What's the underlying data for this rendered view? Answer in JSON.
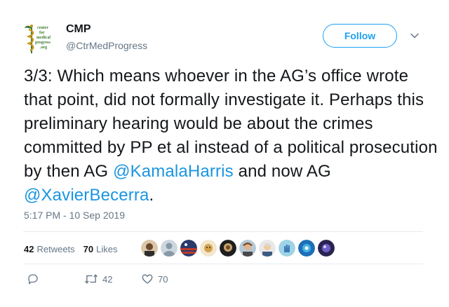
{
  "author": {
    "name": "CMP",
    "handle": "@CtrMedProgress",
    "logo_text": [
      "center",
      "for",
      "medical",
      "progress",
      ".org"
    ]
  },
  "follow_label": "Follow",
  "tweet": {
    "part1": "3/3: Which means whoever in the AG’s office wrote that point, did not formally investigate it. Perhaps this preliminary hearing would be about the crimes committed by PP et al instead of a political prosecution by then AG ",
    "mention1": "@KamalaHarris",
    "part2": " and now AG ",
    "mention2": "@XavierBecerra",
    "part3": "."
  },
  "timestamp": "5:17 PM - 10 Sep 2019",
  "stats": {
    "retweets_count": "42",
    "retweets_label": "Retweets",
    "likes_count": "70",
    "likes_label": "Likes"
  },
  "actions": {
    "reply_count": "",
    "retweet_count": "42",
    "like_count": "70"
  },
  "colors": {
    "accent": "#1da1f2",
    "mention": "#1b95e0",
    "muted": "#657786",
    "divider": "#e6ecf0"
  }
}
